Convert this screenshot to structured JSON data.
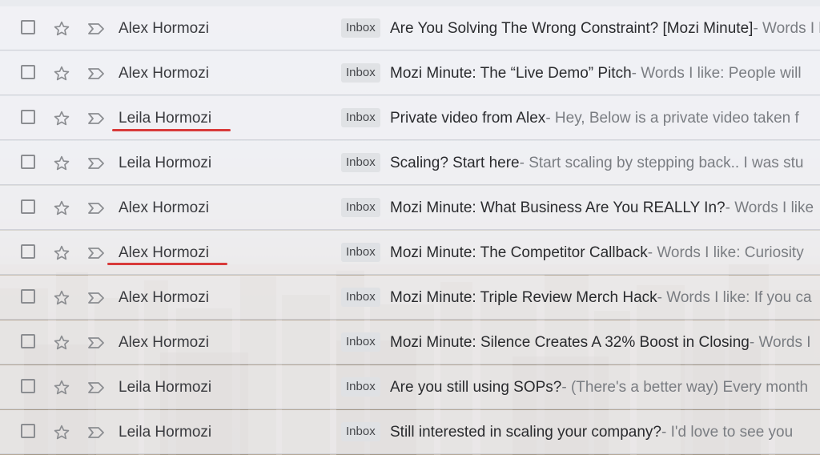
{
  "emails": [
    {
      "sender": "Alex Hormozi",
      "label": "Inbox",
      "subject": "Are You Solving The Wrong Constraint? [Mozi Minute]",
      "snippet": " - Words I like"
    },
    {
      "sender": "Alex Hormozi",
      "label": "Inbox",
      "subject": "Mozi Minute: The “Live Demo” Pitch",
      "snippet": " - Words I like: People will"
    },
    {
      "sender": "Leila Hormozi",
      "label": "Inbox",
      "subject": "Private video from Alex",
      "snippet": " - Hey, Below is a private video taken f"
    },
    {
      "sender": "Leila Hormozi",
      "label": "Inbox",
      "subject": "Scaling? Start here",
      "snippet": " - Start scaling by stepping back.. I was stu"
    },
    {
      "sender": "Alex Hormozi",
      "label": "Inbox",
      "subject": "Mozi Minute: What Business Are You REALLY In?",
      "snippet": " - Words I like"
    },
    {
      "sender": "Alex Hormozi",
      "label": "Inbox",
      "subject": "Mozi Minute: The Competitor Callback",
      "snippet": " - Words I like: Curiosity"
    },
    {
      "sender": "Alex Hormozi",
      "label": "Inbox",
      "subject": "Mozi Minute: Triple Review Merch Hack",
      "snippet": " - Words I like: If you ca"
    },
    {
      "sender": "Alex Hormozi",
      "label": "Inbox",
      "subject": "Mozi Minute: Silence Creates A 32% Boost in Closing",
      "snippet": " - Words I"
    },
    {
      "sender": "Leila Hormozi",
      "label": "Inbox",
      "subject": "Are you still using SOPs?",
      "snippet": " - (There's a better way) Every month"
    },
    {
      "sender": "Leila Hormozi",
      "label": "Inbox",
      "subject": "Still interested in scaling your company?",
      "snippet": " - I'd love to see you"
    }
  ],
  "colors": {
    "annotation_underline": "#d83a3a"
  },
  "icons": {
    "checkbox": "checkbox-icon",
    "star": "star-icon",
    "importance": "importance-marker-icon"
  }
}
